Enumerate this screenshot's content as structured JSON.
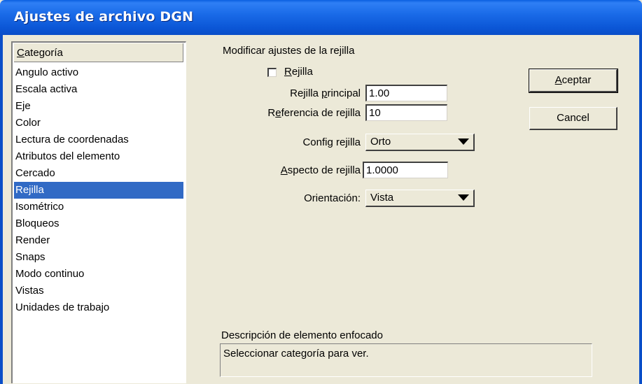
{
  "window": {
    "title": "Ajustes de archivo DGN"
  },
  "category_list": {
    "header": "Categoría",
    "items": [
      "Angulo activo",
      "Escala activa",
      "Eje",
      "Color",
      "Lectura de coordenadas",
      "Atributos del elemento",
      "Cercado",
      "Rejilla",
      "Isométrico",
      "Bloqueos",
      "Render",
      "Snaps",
      "Modo continuo",
      "Vistas",
      "Unidades de trabajo"
    ],
    "selected": "Rejilla"
  },
  "settings": {
    "section_title": "Modificar ajustes de la rejilla",
    "grid_checkbox_label": "Rejilla",
    "grid_checked": false,
    "main_grid_label": "Rejilla principal",
    "main_grid_value": "1.00",
    "grid_ref_label": "Referencia de rejilla",
    "grid_ref_value": "10",
    "config_label": "Config rejilla",
    "config_value": "Orto",
    "aspect_label": "Aspecto de rejilla",
    "aspect_value": "1.0000",
    "orientation_label": "Orientación:",
    "orientation_value": "Vista"
  },
  "buttons": {
    "accept": "Aceptar",
    "cancel": "Cancel"
  },
  "description": {
    "title": "Descripción de elemento enfocado",
    "text": "Seleccionar categoría para ver."
  }
}
